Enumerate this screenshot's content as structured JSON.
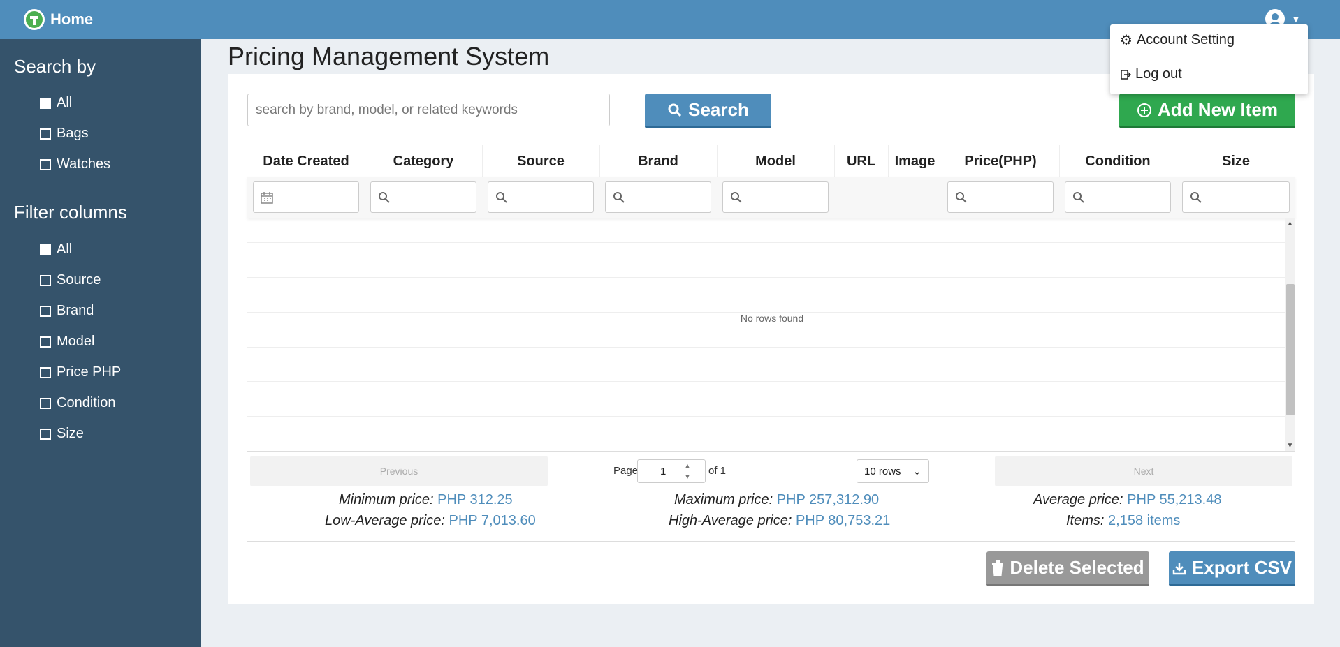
{
  "nav": {
    "brand": "Home",
    "logo_icon": "app-logo-icon",
    "user_icon": "user-circle-icon"
  },
  "user_menu": {
    "account_setting": "Account Setting",
    "logout": "Log out"
  },
  "sidebar": {
    "search_heading": "Search by",
    "search_options": [
      {
        "label": "All",
        "checked": true
      },
      {
        "label": "Bags",
        "checked": false
      },
      {
        "label": "Watches",
        "checked": false
      }
    ],
    "filter_heading": "Filter columns",
    "filter_options": [
      {
        "label": "All",
        "checked": true
      },
      {
        "label": "Source",
        "checked": false
      },
      {
        "label": "Brand",
        "checked": false
      },
      {
        "label": "Model",
        "checked": false
      },
      {
        "label": "Price PHP",
        "checked": false
      },
      {
        "label": "Condition",
        "checked": false
      },
      {
        "label": "Size",
        "checked": false
      }
    ]
  },
  "main": {
    "title": "Pricing Management System",
    "search_placeholder": "search by brand, model, or related keywords",
    "search_button": "Search",
    "add_button": "Add New Item"
  },
  "table": {
    "columns": [
      "Date Created",
      "Category",
      "Source",
      "Brand",
      "Model",
      "URL",
      "Image",
      "Price(PHP)",
      "Condition",
      "Size"
    ],
    "empty_text": "No rows found"
  },
  "pagination": {
    "previous": "Previous",
    "page_label": "Page",
    "page_value": "1",
    "of_label": "of 1",
    "rows_option": "10 rows",
    "next": "Next"
  },
  "stats": {
    "min_label": "Minimum price:",
    "min_value": "PHP 312.25",
    "max_label": "Maximum price:",
    "max_value": "PHP 257,312.90",
    "avg_label": "Average price:",
    "avg_value": "PHP 55,213.48",
    "lowavg_label": "Low-Average price:",
    "lowavg_value": "PHP 7,013.60",
    "highavg_label": "High-Average price:",
    "highavg_value": "PHP 80,753.21",
    "items_label": "Items:",
    "items_value": "2,158 items"
  },
  "actions": {
    "delete": "Delete Selected",
    "export": "Export CSV"
  },
  "colors": {
    "navbar": "#4f8dbb",
    "sidebar": "#35536b",
    "primary": "#4f8dbb",
    "success": "#2fa84f",
    "muted": "#999999",
    "background": "#ebeff3"
  }
}
